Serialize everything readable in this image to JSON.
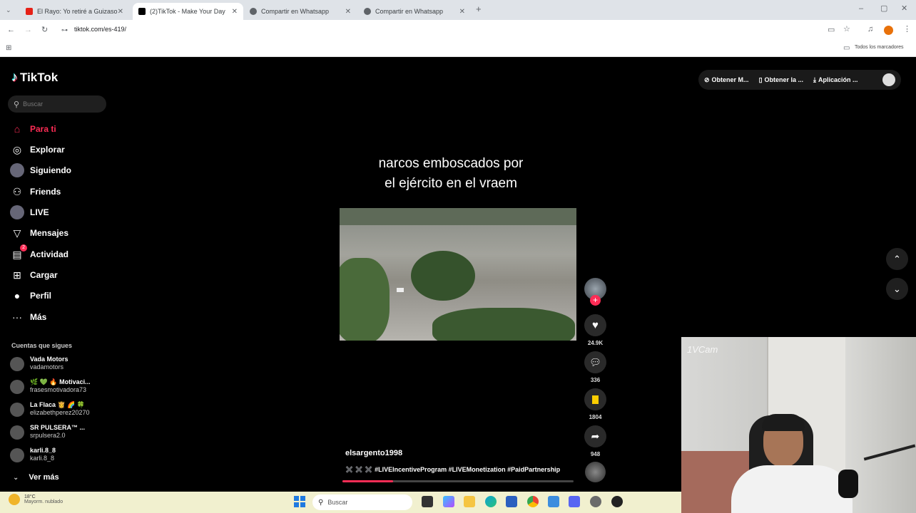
{
  "browser": {
    "tabs": [
      {
        "title": "El Rayo: Yo retiré a Guizasola",
        "favicon": "youtube-icon",
        "color": "#e62117"
      },
      {
        "title": "(2)TikTok - Make Your Day",
        "favicon": "tiktok-icon",
        "color": "#000000"
      },
      {
        "title": "Compartir en Whatsapp",
        "favicon": "globe-icon",
        "color": "#5f6368"
      },
      {
        "title": "Compartir en Whatsapp",
        "favicon": "globe-icon",
        "color": "#5f6368"
      }
    ],
    "url": "tiktok.com/es-419/",
    "bookmarks_label": "Todos los marcadores"
  },
  "tiktok": {
    "logo": "TikTok",
    "search_placeholder": "Buscar",
    "top_actions": [
      "Obtener M...",
      "Obtener la ...",
      "Aplicación ..."
    ],
    "nav": [
      {
        "label": "Para ti",
        "icon": "home-icon",
        "active": true
      },
      {
        "label": "Explorar",
        "icon": "compass-icon"
      },
      {
        "label": "Siguiendo",
        "icon": "following-avatar-icon"
      },
      {
        "label": "Friends",
        "icon": "friends-icon"
      },
      {
        "label": "LIVE",
        "icon": "live-avatar-icon"
      },
      {
        "label": "Mensajes",
        "icon": "send-icon"
      },
      {
        "label": "Actividad",
        "icon": "activity-icon",
        "badge": "2"
      },
      {
        "label": "Cargar",
        "icon": "upload-icon"
      },
      {
        "label": "Perfil",
        "icon": "profile-icon"
      },
      {
        "label": "Más",
        "icon": "more-icon"
      }
    ],
    "following_header": "Cuentas que sigues",
    "following": [
      {
        "name": "Vada Motors",
        "user": "vadamotors"
      },
      {
        "name": "🌿 💚 🔥 Motivaci...",
        "user": "frasesmotivadora73"
      },
      {
        "name": "La Flaca 👸 🌈 🍀",
        "user": "elizabethperez20270"
      },
      {
        "name": "SR PULSERA™ ...",
        "user": "srpulsera2.0"
      },
      {
        "name": "karli.8_8",
        "user": "karli.8_8"
      }
    ],
    "see_more": "Ver más",
    "video": {
      "caption": [
        "narcos emboscados por",
        "el ejército en el vraem"
      ],
      "author": "elsargento1998",
      "description": "✖️ ✖️ ✖️ #LIVEIncentiveProgram #LIVEMonetization #PaidPartnership",
      "progress": 0.22,
      "likes": "24.9K",
      "comments": "336",
      "saves": "1804",
      "shares": "948"
    }
  },
  "webcam_label": "1VCam",
  "taskbar": {
    "weather_temp": "18°C",
    "weather_desc": "Mayorm. nublado",
    "search": "Buscar"
  }
}
